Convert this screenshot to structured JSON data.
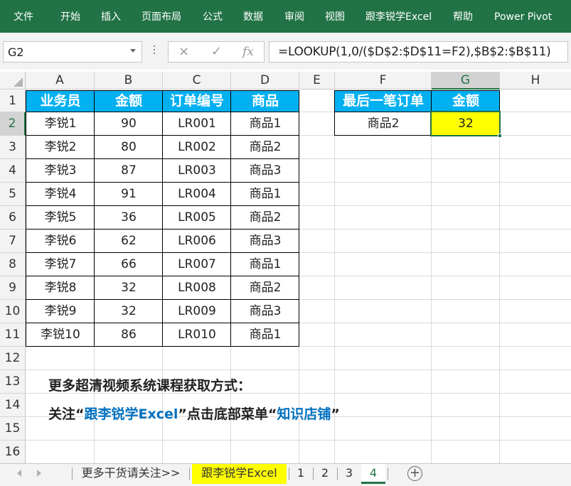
{
  "ribbon": {
    "tabs": [
      "文件",
      "开始",
      "插入",
      "页面布局",
      "公式",
      "数据",
      "审阅",
      "视图",
      "跟李锐学Excel",
      "帮助",
      "Power Pivot"
    ]
  },
  "formula_bar": {
    "name_box": "G2",
    "cancel_icon": "×",
    "enter_icon": "✓",
    "fx_label": "fx",
    "formula": "=LOOKUP(1,0/($D$2:$D$11=F2),$B$2:$B$11)"
  },
  "columns": [
    "A",
    "B",
    "C",
    "D",
    "E",
    "F",
    "G",
    "H"
  ],
  "rows": [
    "1",
    "2",
    "3",
    "4",
    "5",
    "6",
    "7",
    "8",
    "9",
    "10",
    "11",
    "12",
    "13",
    "14",
    "15",
    "16"
  ],
  "table": {
    "headers": [
      "业务员",
      "金额",
      "订单编号",
      "商品"
    ],
    "rows": [
      [
        "李锐1",
        "90",
        "LR001",
        "商品1"
      ],
      [
        "李锐2",
        "80",
        "LR002",
        "商品2"
      ],
      [
        "李锐3",
        "87",
        "LR003",
        "商品3"
      ],
      [
        "李锐4",
        "91",
        "LR004",
        "商品1"
      ],
      [
        "李锐5",
        "36",
        "LR005",
        "商品2"
      ],
      [
        "李锐6",
        "62",
        "LR006",
        "商品3"
      ],
      [
        "李锐7",
        "66",
        "LR007",
        "商品1"
      ],
      [
        "李锐8",
        "32",
        "LR008",
        "商品2"
      ],
      [
        "李锐9",
        "32",
        "LR009",
        "商品3"
      ],
      [
        "李锐10",
        "86",
        "LR010",
        "商品1"
      ]
    ]
  },
  "result": {
    "headers": [
      "最后一笔订单",
      "金额"
    ],
    "product": "商品2",
    "amount": "32"
  },
  "notes": {
    "line1": "更多超清视频系统课程获取方式：",
    "line2_a": "关注“",
    "line2_b": "跟李锐学Excel",
    "line2_c": "”点击底部菜单“",
    "line2_d": "知识店铺",
    "line2_e": "”"
  },
  "sheet_tabs": {
    "items": [
      "更多干货请关注>>",
      "跟李锐学Excel",
      "1",
      "2",
      "3",
      "4"
    ],
    "active": "4",
    "add_icon": "+"
  },
  "colors": {
    "ribbon": "#217346",
    "header_fill": "#00b0f0",
    "highlight_fill": "#ffff00",
    "note_accent": "#0070c0"
  }
}
